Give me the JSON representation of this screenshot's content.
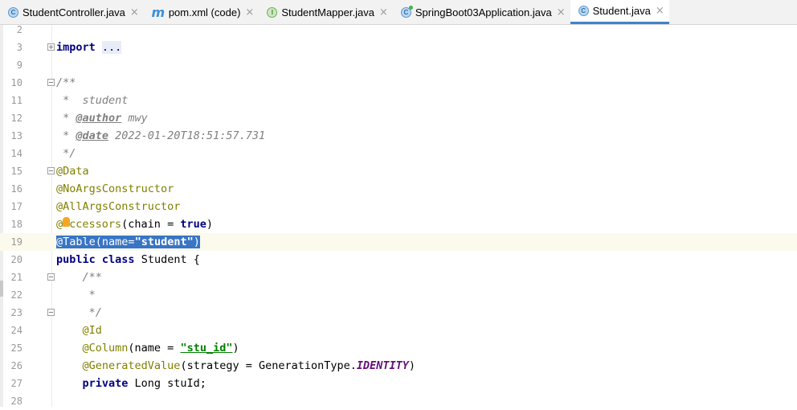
{
  "tabs": [
    {
      "label": "StudentController.java",
      "icon": "class-icon",
      "active": false
    },
    {
      "label": "pom.xml (code)",
      "icon": "maven-icon",
      "active": false
    },
    {
      "label": "StudentMapper.java",
      "icon": "interface-icon",
      "active": false
    },
    {
      "label": "SpringBoot03Application.java",
      "icon": "spring-run-class-icon",
      "active": false
    },
    {
      "label": "Student.java",
      "icon": "class-icon",
      "active": true
    }
  ],
  "tab_close_glyph": "×",
  "editor": {
    "current_line": 19,
    "lines": [
      {
        "n": "2"
      },
      {
        "n": "3",
        "import_kw": "import",
        "import_dots": "..."
      },
      {
        "n": "9"
      },
      {
        "n": "10",
        "text": "/**"
      },
      {
        "n": "11",
        "text": " *  student"
      },
      {
        "n": "12",
        "prefix": " * ",
        "tag": "@author",
        "rest": " mwy"
      },
      {
        "n": "13",
        "prefix": " * ",
        "tag": "@date",
        "rest": " 2022-01-20T18:51:57.731"
      },
      {
        "n": "14",
        "text": " */"
      },
      {
        "n": "15",
        "text": "@Data"
      },
      {
        "n": "16",
        "text": "@NoArgsConstructor"
      },
      {
        "n": "17",
        "text": "@AllArgsConstructor"
      },
      {
        "n": "18",
        "ann_a": "@",
        "ann_b": "ccessors",
        "mid": "(chain = ",
        "kw": "true",
        "end": ")"
      },
      {
        "n": "19",
        "ann": "@Table",
        "open": "(name=",
        "str": "\"student\"",
        "close": ")"
      },
      {
        "n": "20",
        "kw1": "public",
        "kw2": "class",
        "rest": " Student {"
      },
      {
        "n": "21",
        "text": "    /**"
      },
      {
        "n": "22",
        "text": "     *"
      },
      {
        "n": "23",
        "text": "     */"
      },
      {
        "n": "24",
        "text": "    @Id"
      },
      {
        "n": "25",
        "ann": "    @Column",
        "open": "(name = ",
        "str": "\"stu_id\"",
        "close": ")"
      },
      {
        "n": "26",
        "ann": "    @GeneratedValue",
        "open": "(strategy = GenerationType.",
        "const": "IDENTITY",
        "close": ")"
      },
      {
        "n": "27",
        "kw": "    private",
        "rest": " Long stuId;"
      },
      {
        "n": "28"
      }
    ]
  },
  "colors": {
    "keyword": "#000080",
    "annotation": "#808000",
    "string": "#008000",
    "comment": "#808080",
    "selection": "#3875c5",
    "active_tab_underline": "#4083c9"
  }
}
